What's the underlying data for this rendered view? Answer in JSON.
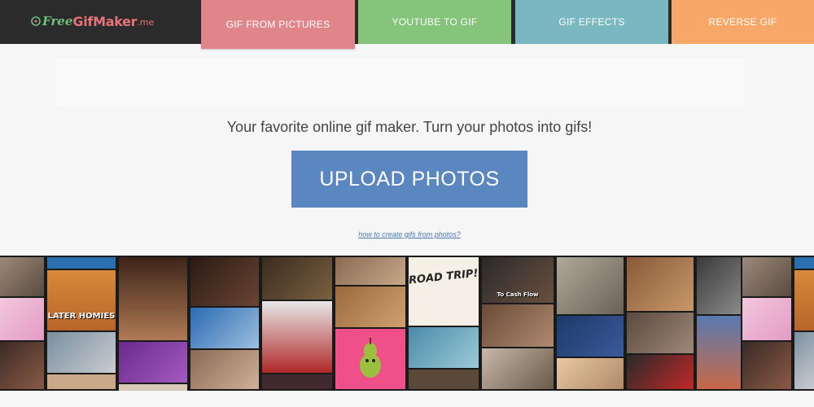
{
  "logo": {
    "part1": "Free",
    "part2": "GifMaker",
    "part3": ".me",
    "icon": "gif-reel-icon"
  },
  "nav": {
    "tabs": [
      {
        "label": "GIF FROM PICTURES",
        "color": "#e0868a",
        "active": true
      },
      {
        "label": "YOUTUBE TO GIF",
        "color": "#84c47b",
        "active": false
      },
      {
        "label": "GIF EFFECTS",
        "color": "#7ab8c1",
        "active": false
      },
      {
        "label": "REVERSE GIF",
        "color": "#f7a767",
        "active": false
      }
    ]
  },
  "main": {
    "tagline": "Your favorite online gif maker. Turn your photos into gifs!",
    "upload_label": "UPLOAD PHOTOS",
    "howto_link": "how to create gifs from photos?"
  },
  "gif_strip": {
    "captions": {
      "later_homies": "LATER HOMIES",
      "road_trip": "ROAD TRIP!",
      "to_cash_flow": "To Cash Flow"
    }
  },
  "colors": {
    "topbar": "#2b2b2b",
    "page_background": "#f6f6f6",
    "upload_button": "#5b87c1",
    "link": "#4a77b5"
  }
}
